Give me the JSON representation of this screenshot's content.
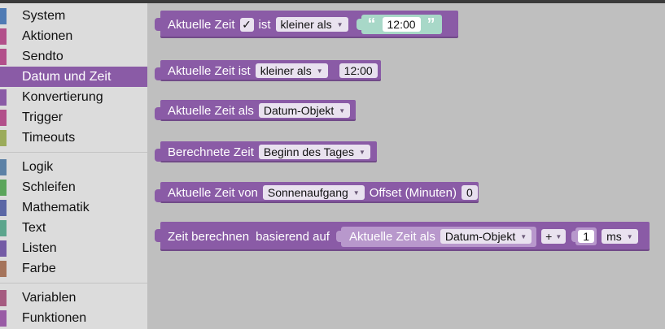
{
  "sidebar": {
    "categories": [
      {
        "label": "System",
        "color": "#4f7bb4"
      },
      {
        "label": "Aktionen",
        "color": "#b24f8a"
      },
      {
        "label": "Sendto",
        "color": "#b24f8a"
      },
      {
        "label": "Datum und Zeit",
        "color": "#8a5ba6",
        "active": true
      },
      {
        "label": "Konvertierung",
        "color": "#8a5ba6"
      },
      {
        "label": "Trigger",
        "color": "#b24f8a"
      },
      {
        "label": "Timeouts",
        "color": "#9bab5a"
      },
      {
        "label": "Logik",
        "color": "#5c81a6"
      },
      {
        "label": "Schleifen",
        "color": "#5ba55b"
      },
      {
        "label": "Mathematik",
        "color": "#5b67a5"
      },
      {
        "label": "Text",
        "color": "#5ba58c"
      },
      {
        "label": "Listen",
        "color": "#745ba5"
      },
      {
        "label": "Farbe",
        "color": "#a5745b"
      },
      {
        "label": "Variablen",
        "color": "#a55b80"
      },
      {
        "label": "Funktionen",
        "color": "#995ba5"
      }
    ]
  },
  "blocks": {
    "b1": {
      "prefix": "Aktuelle Zeit",
      "check": "✓",
      "mid": "ist",
      "op": "kleiner als",
      "value": "12:00"
    },
    "b2": {
      "prefix": "Aktuelle Zeit ist",
      "op": "kleiner als",
      "value": "12:00"
    },
    "b3": {
      "prefix": "Aktuelle Zeit als",
      "format": "Datum-Objekt"
    },
    "b4": {
      "prefix": "Berechnete Zeit",
      "option": "Beginn des Tages"
    },
    "b5": {
      "prefix": "Aktuelle Zeit von",
      "option": "Sonnenaufgang",
      "offset_label": "Offset (Minuten)",
      "offset_value": "0"
    },
    "b6": {
      "prefix": "Zeit berechnen",
      "based_on": "basierend auf",
      "inner_prefix": "Aktuelle Zeit als",
      "inner_format": "Datum-Objekt",
      "operator": "+",
      "amount": "1",
      "unit": "ms"
    }
  }
}
